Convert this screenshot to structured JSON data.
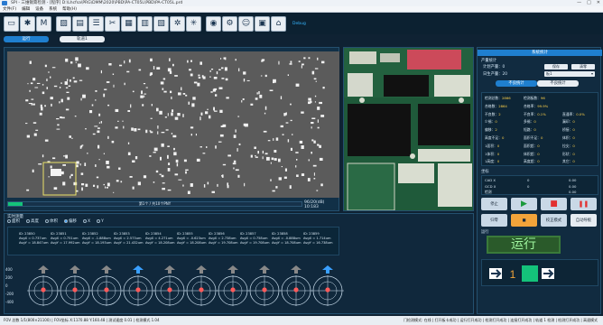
{
  "window": {
    "title": "SPI - 三维锡膏检测 - [程序] D:\\Lhcfsa\\PRG\\DMM\\2020\\PBD\\PA-CT05L\\PBD\\PA-CT05L.prd",
    "controls": [
      "—",
      "□",
      "✕"
    ]
  },
  "menu": [
    "文件(F)",
    "编辑",
    "设备",
    "系统",
    "帮助(H)"
  ],
  "toolbar": {
    "buttons": [
      {
        "name": "open-file-icon",
        "glyph": "▭"
      },
      {
        "name": "settings-icon",
        "glyph": "✱"
      },
      {
        "name": "manual-icon",
        "glyph": "M"
      },
      {
        "name": "image-icon",
        "glyph": "▨"
      },
      {
        "name": "layers-icon",
        "glyph": "▤"
      },
      {
        "name": "list-icon",
        "glyph": "☰"
      },
      {
        "name": "tools-icon",
        "glyph": "✂"
      },
      {
        "name": "grid-icon",
        "glyph": "▦"
      },
      {
        "name": "chart-icon",
        "glyph": "▥"
      },
      {
        "name": "film-icon",
        "glyph": "▧"
      },
      {
        "name": "fan-icon",
        "glyph": "✲"
      },
      {
        "name": "fan2-icon",
        "glyph": "✳"
      },
      {
        "name": "camera-icon",
        "glyph": "◉"
      },
      {
        "name": "gear-icon",
        "glyph": "⚙"
      },
      {
        "name": "user-icon",
        "glyph": "☺"
      },
      {
        "name": "screen-icon",
        "glyph": "▣"
      },
      {
        "name": "home-icon",
        "glyph": "⌂"
      }
    ],
    "version": "Debug"
  },
  "tabs": {
    "run": "运行",
    "debug": "轨道1"
  },
  "progress": {
    "text": "第1个 / 共10个PNY",
    "count": "96/20(dB) 10:183",
    "fraction": 0.05
  },
  "data_panel": {
    "title": "实时测量",
    "radios": [
      {
        "label": "面积",
        "on": false
      },
      {
        "label": "高度",
        "on": false
      },
      {
        "label": "体积",
        "on": false
      },
      {
        "label": "偏移",
        "on": true
      },
      {
        "label": "X",
        "on": false
      },
      {
        "label": "Y",
        "on": false
      }
    ],
    "columns": [
      [
        "ID: 23850",
        "AvgX = 0.737um",
        "AvgY = 18.847um"
      ],
      [
        "ID: 23851",
        "AvgX = 0.751um",
        "AvgY = 17.992um"
      ],
      [
        "ID: 23852",
        "AvgX = -1.888um",
        "AvgY = 18.193um"
      ],
      [
        "ID: 23853",
        "AvgX = 2.573um",
        "AvgY = 21.432um"
      ],
      [
        "ID: 23854",
        "AvgX = 4.271um",
        "AvgY = 18.208um"
      ],
      [
        "ID: 23855",
        "AvgX = -0.623um",
        "AvgY = 18.208um"
      ],
      [
        "ID: 23856",
        "AvgX = 2.738um",
        "AvgY = 19.708um"
      ],
      [
        "ID: 23857",
        "AvgX = 0.758um",
        "AvgY = 19.708um"
      ],
      [
        "ID: 23858",
        "AvgX = -0.888um",
        "AvgY = 18.708um"
      ],
      [
        "ID: 23859",
        "AvgX = 1.714um",
        "AvgY = 16.738um"
      ]
    ],
    "axis_labels": [
      "400",
      "200",
      "0",
      "-200",
      "-400"
    ],
    "gauge_colors": [
      "#888888",
      "#888888",
      "#888888",
      "#3aa0ff",
      "#888888",
      "#888888",
      "#888888",
      "#888888",
      "#888888",
      "#3aa0ff"
    ]
  },
  "control": {
    "header": "系统统计",
    "group_title": "产量统计",
    "program_label": "计划产量：0",
    "start_label": "日生产量：20",
    "btn_save": "保存",
    "btn_clear": "清零",
    "select_value": "板1",
    "subtabs": [
      "不良统计",
      "不良统计"
    ],
    "stats": [
      [
        "检测总数：",
        "2866",
        "检测板数：",
        "96"
      ],
      [
        "合格数：",
        "2864",
        "合格率：",
        "99.9%"
      ],
      [
        "不良数：",
        "2",
        "不良率：",
        "0.1%",
        "直通率：",
        "0.0%"
      ],
      [
        "少锡：",
        "0",
        "多锡：",
        "0",
        "漏印：",
        "0"
      ],
      [
        "偏移：",
        "2",
        "短路：",
        "0",
        "桥接：",
        "0"
      ],
      [
        "高度不足：",
        "0",
        "面积不足：",
        "0",
        "体积：",
        "0"
      ],
      [
        "1面积：",
        "0",
        "面积超：",
        "0",
        "拉尖：",
        "0"
      ],
      [
        "1体积：",
        "0",
        "体积超：",
        "0",
        "形状：",
        "0"
      ],
      [
        "1高度：",
        "0",
        "高度超：",
        "0",
        "其它：",
        "0"
      ]
    ],
    "coords_title": "坐标",
    "coords": [
      [
        "CAD X",
        "0",
        "0.00"
      ],
      [
        "GCD X",
        "0",
        "0.00"
      ],
      [
        "检测",
        "",
        "0.00"
      ]
    ],
    "buttons": {
      "stop": "停止",
      "play": "▶",
      "record": "■",
      "pause": "❚❚",
      "home": "归零",
      "calib": "校正模式",
      "auto": "自动导板"
    },
    "run_label": "运行",
    "flow_label": "运行",
    "board_count": "1"
  },
  "status": {
    "left": "FOV 总数 1/1(800×21100) | FOV坐标 X:1170.88 Y:160.48 | 测试速度 0.01 | 检测模式 1.04",
    "right": "门检测模式: 在线 | 打开板卡成功 | 运行打开成功 | 检测打开成功 | 连接打开成功 | 轨道 1 检测 | 检测打开成功 | 高速模式"
  }
}
